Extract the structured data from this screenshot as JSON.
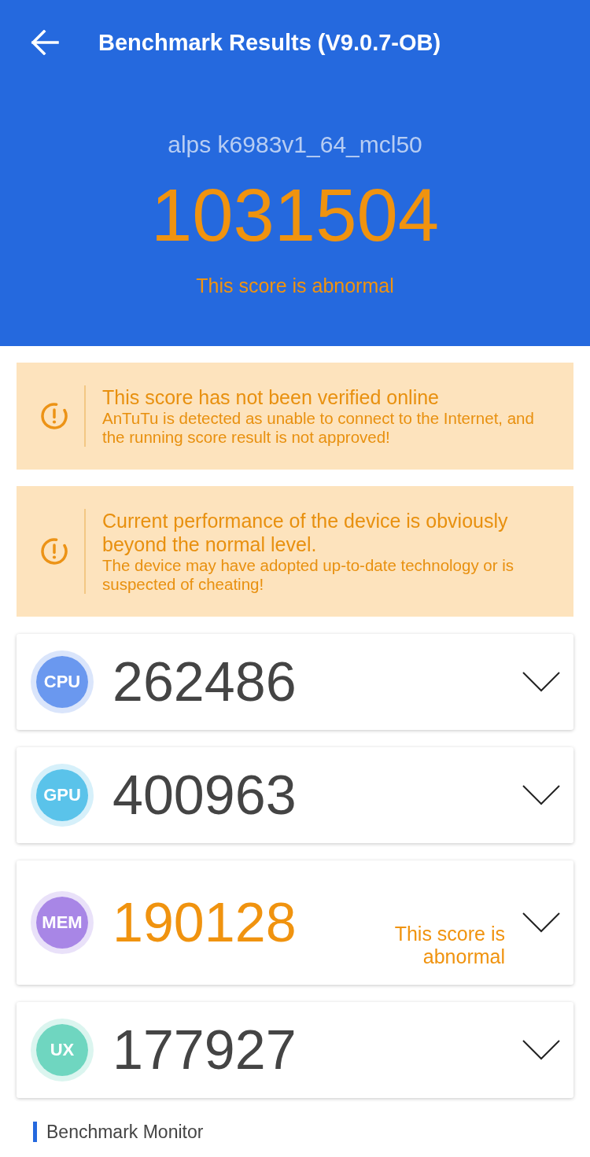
{
  "header": {
    "title": "Benchmark Results (V9.0.7-OB)",
    "device": "alps k6983v1_64_mcl50",
    "score": "1031504",
    "abnormal": true,
    "note": "This score is abnormal"
  },
  "warnings": [
    {
      "title": "This score has not been verified online",
      "message": "AnTuTu is detected as unable to connect to the Internet, and the running score result is not approved!"
    },
    {
      "title": "Current performance of the device is obviously beyond the normal level.",
      "message": "The device may have adopted up-to-date technology or is suspected of cheating!"
    }
  ],
  "categories": [
    {
      "label": "CPU",
      "score": "262486",
      "color": "#6a98ef",
      "abnormal": false
    },
    {
      "label": "GPU",
      "score": "400963",
      "color": "#5ac3ea",
      "abnormal": false
    },
    {
      "label": "MEM",
      "score": "190128",
      "color": "#a886e6",
      "abnormal": true,
      "note": "This score is abnormal"
    },
    {
      "label": "UX",
      "score": "177927",
      "color": "#6fd6c0",
      "abnormal": false
    }
  ],
  "section": {
    "title": "Benchmark Monitor"
  }
}
